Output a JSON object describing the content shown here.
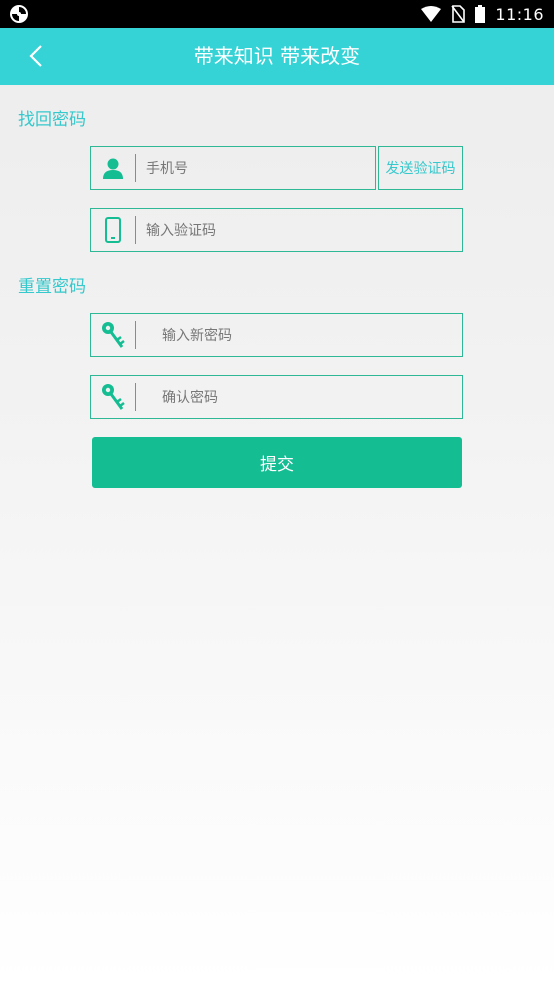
{
  "status_bar": {
    "time": "11:16"
  },
  "header": {
    "title": "带来知识 带来改变"
  },
  "recover_section": {
    "title": "找回密码",
    "phone_placeholder": "手机号",
    "send_code_label": "发送验证码",
    "code_placeholder": "输入验证码"
  },
  "reset_section": {
    "title": "重置密码",
    "new_password_placeholder": "输入新密码",
    "confirm_password_placeholder": "确认密码"
  },
  "submit_label": "提交",
  "colors": {
    "accent": "#35d2d6",
    "field_border": "#2fb896",
    "button": "#14bd92",
    "section_text": "#35c8cc"
  }
}
